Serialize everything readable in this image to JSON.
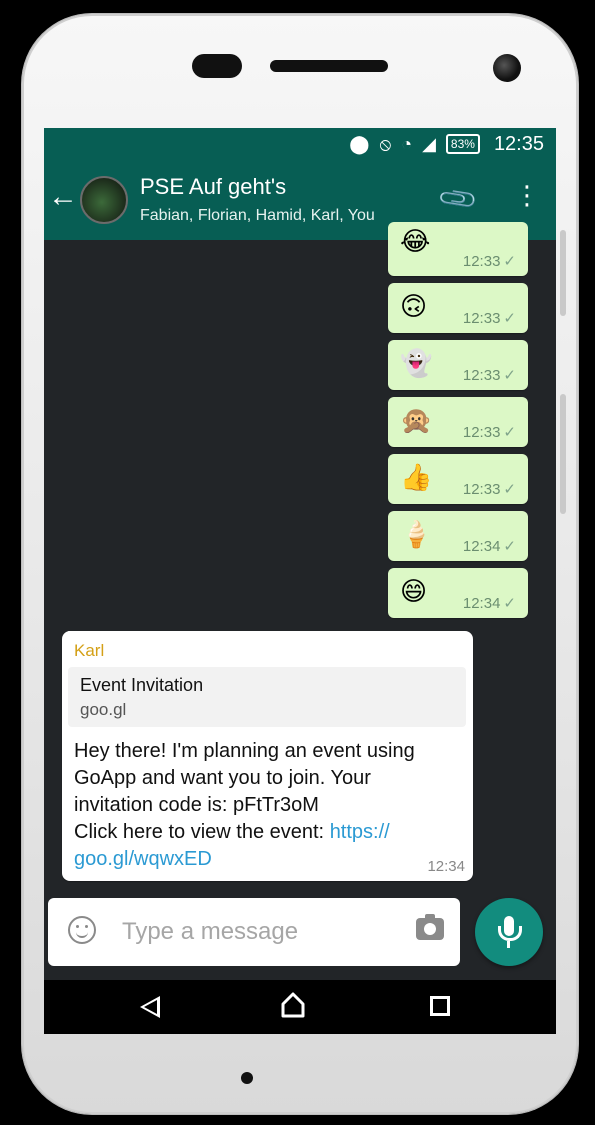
{
  "status_bar": {
    "location_icon": "location-pin-icon",
    "dnd_icon": "do-not-disturb-icon",
    "battery": "83%",
    "time": "12:35"
  },
  "chat": {
    "title": "PSE Auf geht's",
    "participants": "Fabian, Florian, Hamid, Karl, You"
  },
  "outgoing_messages": [
    {
      "emoji": "😂",
      "time": "12:33",
      "tick": "✓"
    },
    {
      "emoji": "🙃",
      "time": "12:33",
      "tick": "✓"
    },
    {
      "emoji": "👻",
      "time": "12:33",
      "tick": "✓"
    },
    {
      "emoji": "🙊",
      "time": "12:33",
      "tick": "✓"
    },
    {
      "emoji": "👍",
      "time": "12:33",
      "tick": "✓"
    },
    {
      "emoji": "🍦",
      "time": "12:34",
      "tick": "✓"
    },
    {
      "emoji": "😄",
      "time": "12:34",
      "tick": "✓"
    }
  ],
  "incoming_message": {
    "sender": "Karl",
    "preview_title": "Event Invitation",
    "preview_url": "goo.gl",
    "text_line1": "Hey there! I'm planning an event using",
    "text_line2": "GoApp and want you to join. Your",
    "text_line3": "invitation code is: pFtTr3oM",
    "text_line4": "Click here to view the event: ",
    "link_part1": "https://",
    "link_part2": "goo.gl/wqwxED",
    "time": "12:34"
  },
  "composer": {
    "placeholder": "Type a message"
  },
  "colors": {
    "header": "#075e54",
    "outgoing_bubble": "#dcf8c6",
    "mic_button": "#128c7e",
    "sender_name": "#d4a017",
    "link": "#2b9ad3"
  }
}
